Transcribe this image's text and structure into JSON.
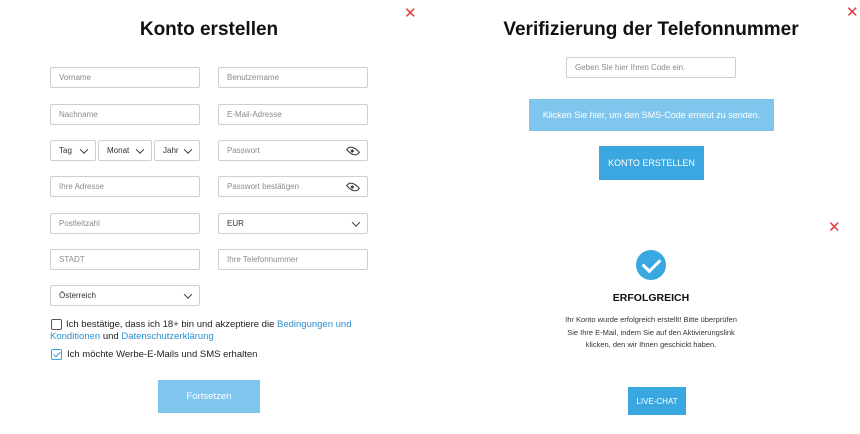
{
  "left": {
    "title": "Konto erstellen",
    "placeholders": {
      "first_name": "Vorname",
      "username": "Benutzername",
      "last_name": "Nachname",
      "email": "E-Mail-Adresse",
      "password": "Passwort",
      "address": "Ihre Adresse",
      "password_confirm": "Passwort bestätigen",
      "postal_code": "Postleitzahl",
      "city": "STADT",
      "phone": "Ihre Telefonnummer"
    },
    "selects": {
      "day": "Tag",
      "month": "Monat",
      "year": "Jahr",
      "currency": "EUR",
      "country": "Österreich"
    },
    "terms": {
      "prefix": "Ich bestätige, dass ich 18+ bin und akzeptiere die ",
      "link1": "Bedingungen und Konditionen",
      "middle": " und ",
      "link2": "Datenschutzerklärung"
    },
    "marketing_label": "Ich möchte Werbe-E-Mails und SMS erhalten",
    "submit_label": "Fortsetzen"
  },
  "right_top": {
    "title": "Verifizierung der Telefonnummer",
    "code_placeholder": "Geben Sie hier Ihren Code ein.",
    "resend_label": "Klicken Sie hier, um den SMS-Code erneut zu senden.",
    "create_label": "KONTO ERSTELLEN"
  },
  "right_bottom": {
    "heading": "ERFOLGREICH",
    "message": "Ihr Konto wurde erfolgreich erstellt! Bitte überprüfen Sie Ihre E-Mail, indem Sie auf den Aktivierungslink klicken, den wir Ihnen geschickt haben.",
    "chat_label": "LIVE-CHAT"
  },
  "colors": {
    "accent": "#3ba7e0",
    "button_light": "#7fc6ee",
    "close": "#e53935"
  }
}
